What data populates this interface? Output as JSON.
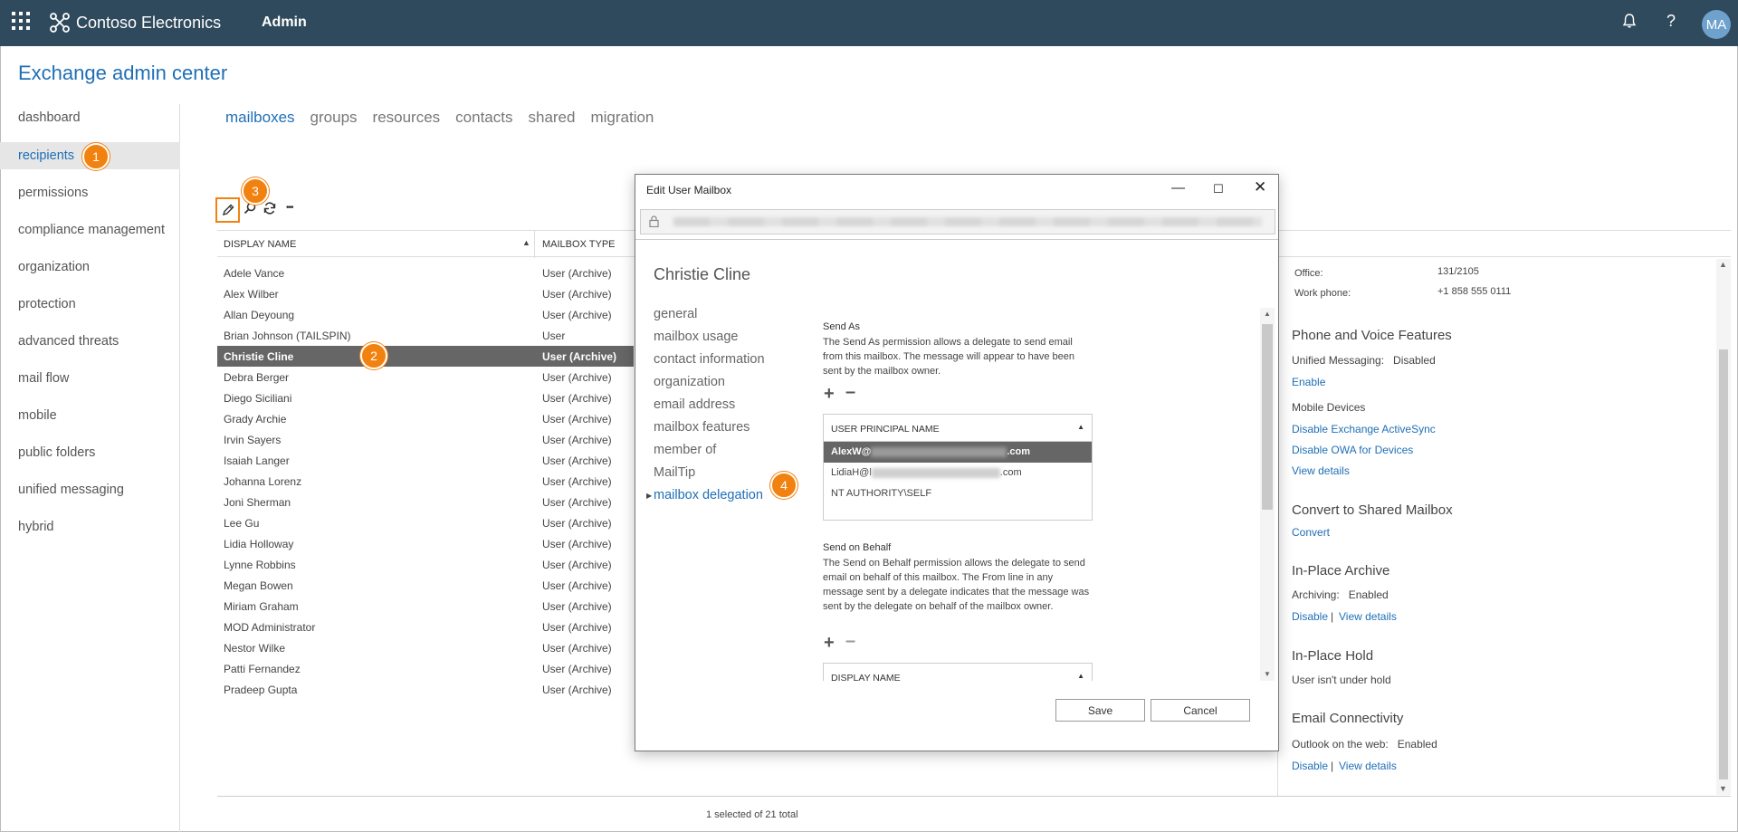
{
  "topbar": {
    "brand": "Contoso Electronics",
    "app_name": "Admin",
    "icons": [
      "waffle-icon",
      "bell-icon",
      "help-icon"
    ],
    "avatar": "MA",
    "colors": {
      "bar": "#2f4a5c",
      "accent": "#1f6fb7",
      "badge": "#f2820f"
    }
  },
  "page_title": "Exchange admin center",
  "nav": {
    "items": [
      "dashboard",
      "recipients",
      "permissions",
      "compliance management",
      "organization",
      "protection",
      "advanced threats",
      "mail flow",
      "mobile",
      "public folders",
      "unified messaging",
      "hybrid"
    ],
    "active": "recipients"
  },
  "badges": [
    "1",
    "2",
    "3",
    "4"
  ],
  "tabs": {
    "items": [
      "mailboxes",
      "groups",
      "resources",
      "contacts",
      "shared",
      "migration"
    ],
    "active": "mailboxes"
  },
  "toolbar": {
    "icons": [
      "edit-icon",
      "search-icon",
      "refresh-icon",
      "more-icon"
    ],
    "more_label": "•••"
  },
  "table": {
    "columns": [
      "DISPLAY NAME",
      "MAILBOX TYPE"
    ],
    "rows": [
      [
        "Adele Vance",
        "User (Archive)"
      ],
      [
        "Alex Wilber",
        "User (Archive)"
      ],
      [
        "Allan Deyoung",
        "User (Archive)"
      ],
      [
        "Brian Johnson (TAILSPIN)",
        "User"
      ],
      [
        "Christie Cline",
        "User (Archive)"
      ],
      [
        "Debra Berger",
        "User (Archive)"
      ],
      [
        "Diego Siciliani",
        "User (Archive)"
      ],
      [
        "Grady Archie",
        "User (Archive)"
      ],
      [
        "Irvin Sayers",
        "User (Archive)"
      ],
      [
        "Isaiah Langer",
        "User (Archive)"
      ],
      [
        "Johanna Lorenz",
        "User (Archive)"
      ],
      [
        "Joni Sherman",
        "User (Archive)"
      ],
      [
        "Lee Gu",
        "User (Archive)"
      ],
      [
        "Lidia Holloway",
        "User (Archive)"
      ],
      [
        "Lynne Robbins",
        "User (Archive)"
      ],
      [
        "Megan Bowen",
        "User (Archive)"
      ],
      [
        "Miriam Graham",
        "User (Archive)"
      ],
      [
        "MOD Administrator",
        "User (Archive)"
      ],
      [
        "Nestor Wilke",
        "User (Archive)"
      ],
      [
        "Patti Fernandez",
        "User (Archive)"
      ],
      [
        "Pradeep Gupta",
        "User (Archive)"
      ]
    ],
    "selected_index": 4,
    "footer": "1 selected of 21 total"
  },
  "details": {
    "office_label": "Office:",
    "office_value": "131/2105",
    "work_phone_label": "Work phone:",
    "work_phone_value": "+1 858 555 0111",
    "phone_voice_heading": "Phone and Voice Features",
    "unified_messaging": "Unified Messaging:   Disabled",
    "enable_link": "Enable",
    "mobile_devices": "Mobile Devices",
    "disable_activesync": "Disable Exchange ActiveSync",
    "disable_owa": "Disable OWA for Devices",
    "view_details": "View details",
    "convert_heading": "Convert to Shared Mailbox",
    "convert_link": "Convert",
    "archive_heading": "In-Place Archive",
    "archiving": "Archiving:   Enabled",
    "disable_link": "Disable",
    "separator": "|",
    "hold_heading": "In-Place Hold",
    "hold_status": "User isn't under hold",
    "email_heading": "Email Connectivity",
    "owa_status": "Outlook on the web:   Enabled"
  },
  "dialog": {
    "title": "Edit User Mailbox",
    "window_icons": [
      "minimize-icon",
      "maximize-icon",
      "close-icon"
    ],
    "user_name": "Christie Cline",
    "nav": [
      "general",
      "mailbox usage",
      "contact information",
      "organization",
      "email address",
      "mailbox features",
      "member of",
      "MailTip",
      "mailbox delegation"
    ],
    "active_nav": "mailbox delegation",
    "send_as": {
      "title": "Send As",
      "desc": "The Send As permission allows a delegate to send email from this mailbox. The message will appear to have been sent by the mailbox owner.",
      "column": "USER PRINCIPAL NAME",
      "items": [
        {
          "prefix": "AlexW@",
          "suffix": ".com"
        },
        {
          "prefix": "LidiaH@l",
          "suffix": ".com"
        },
        {
          "prefix": "NT AUTHORITY\\SELF",
          "suffix": ""
        }
      ]
    },
    "send_on_behalf": {
      "title": "Send on Behalf",
      "desc": "The Send on Behalf permission allows the delegate to send email on behalf of this mailbox. The From line in any message sent by a delegate indicates that the message was sent by the delegate on behalf of the mailbox owner.",
      "column": "DISPLAY NAME"
    },
    "save": "Save",
    "cancel": "Cancel"
  }
}
